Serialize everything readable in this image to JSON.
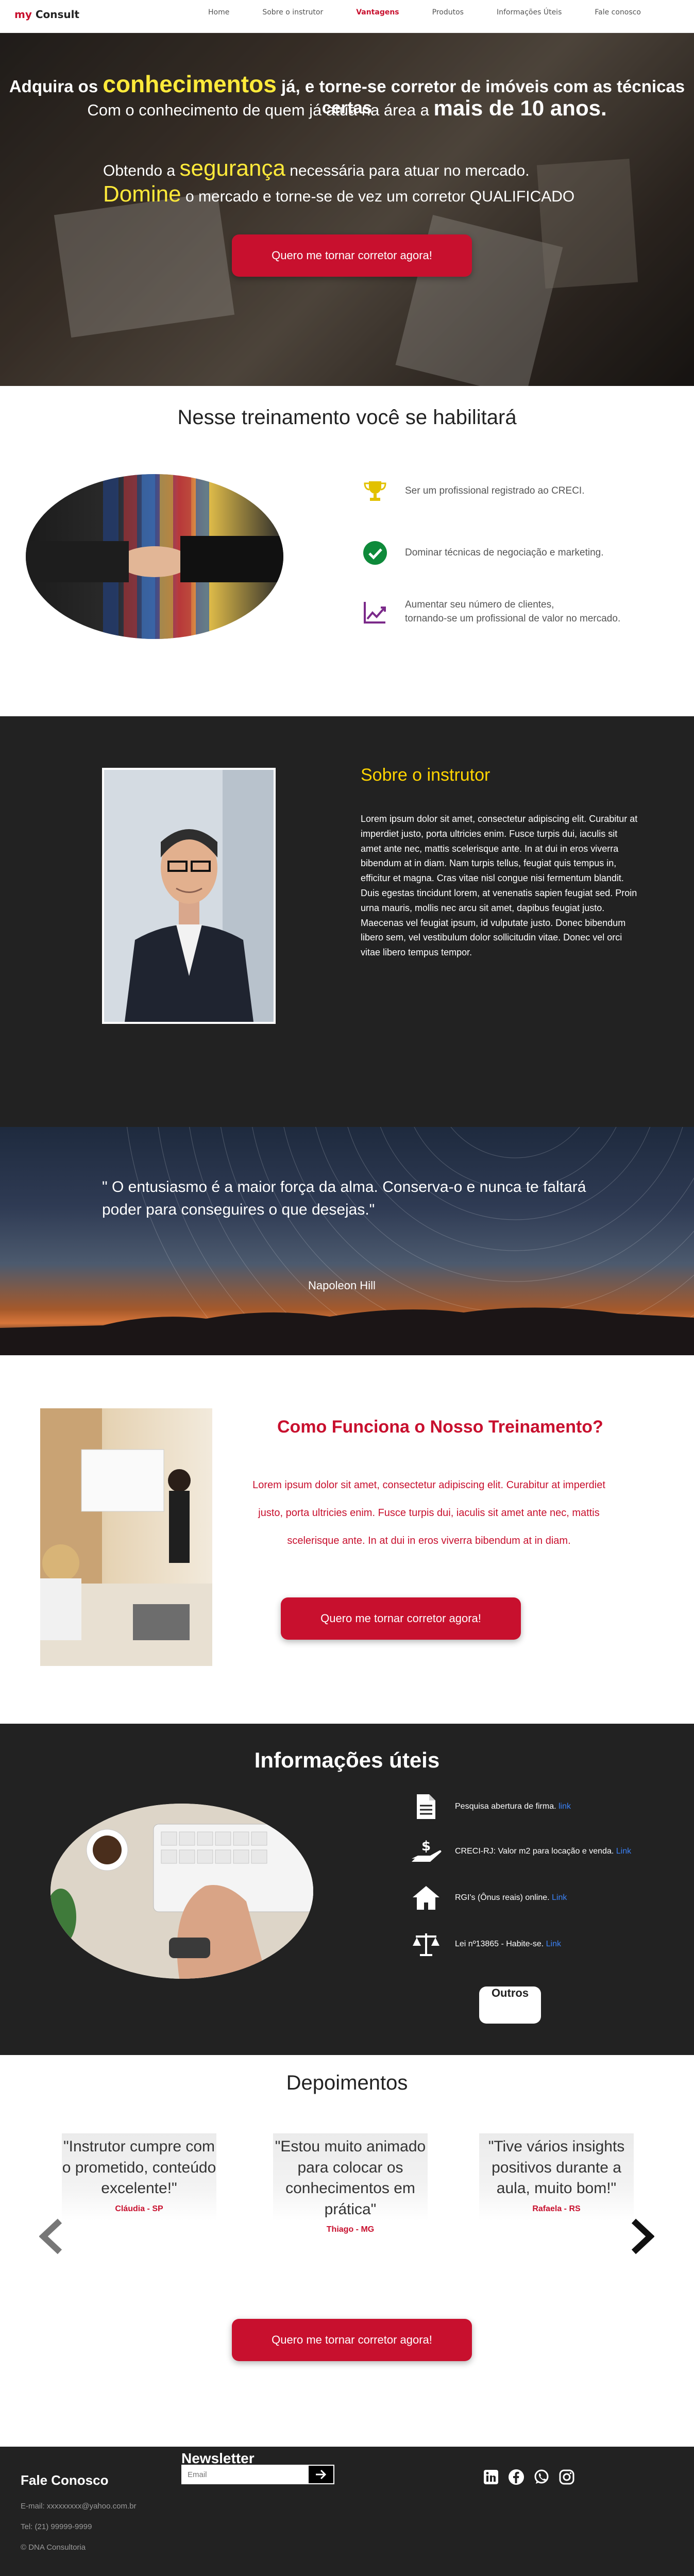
{
  "nav": {
    "logo_my": "my",
    "logo_consult": "Consult",
    "items": [
      "Home",
      "Sobre o instrutor",
      "Vantagens",
      "Produtos",
      "Informações Úteis",
      "Fale conosco"
    ],
    "active": "Vantagens"
  },
  "hero": {
    "line1_a": "Adquira os",
    "line1_b": "conhecimentos",
    "line1_c": "já, e torne-se corretor de imóveis com as técnicas certas",
    "line2_a": "Com o conhecimento de quem já atua na área a",
    "line2_b": "mais de 10 anos.",
    "line3_a": "Obtendo a",
    "line3_b": "segurança",
    "line3_c": "necessária para atuar no mercado.",
    "line4_a": "Domine",
    "line4_b": "o mercado e torne-se de vez um corretor QUALIFICADO",
    "cta": "Quero me tornar corretor agora!"
  },
  "habilitar": {
    "title": "Nesse treinamento você se habilitará",
    "items": [
      {
        "icon": "trophy-icon",
        "text": "Ser um profissional registrado ao CRECI."
      },
      {
        "icon": "check-circle-icon",
        "text": "Dominar técnicas de negociação e marketing."
      },
      {
        "icon": "trend-up-icon",
        "text_line1": "Aumentar seu número de clientes,",
        "text_line2": "tornando-se um profissional de valor no mercado."
      }
    ]
  },
  "instrutor": {
    "title": "Sobre o instrutor",
    "text": "Lorem ipsum dolor sit amet, consectetur adipiscing elit. Curabitur at imperdiet justo, porta ultricies enim. Fusce turpis dui, iaculis sit amet ante nec, mattis scelerisque ante. In at dui in eros viverra bibendum at in diam. Nam turpis tellus, feugiat quis tempus in, efficitur et magna. Cras vitae nisl congue nisi fermentum blandit. Duis egestas tincidunt lorem, at venenatis sapien feugiat sed. Proin urna mauris, mollis nec arcu sit amet, dapibus feugiat justo. Maecenas vel feugiat ipsum, id vulputate justo. Donec bibendum libero sem, vel vestibulum dolor sollicitudin vitae. Donec vel orci vitae libero tempus tempor."
  },
  "quote": {
    "text": "\" O entusiasmo é a maior força da alma. Conserva-o e nunca te faltará poder para conseguires o que desejas.\"",
    "author": "Napoleon Hill"
  },
  "como": {
    "title": "Como Funciona o Nosso Treinamento?",
    "text": "Lorem ipsum dolor sit amet, consectetur adipiscing elit. Curabitur at imperdiet justo, porta ultricies enim. Fusce turpis dui, iaculis sit amet ante nec, mattis scelerisque ante. In at dui in eros viverra bibendum at in diam.",
    "cta": "Quero me tornar corretor agora!"
  },
  "info": {
    "title": "Informações úteis",
    "items": [
      {
        "icon": "document-icon",
        "text": "Pesquisa abertura de firma.",
        "link": "link"
      },
      {
        "icon": "hand-money-icon",
        "text": "CRECI-RJ: Valor m2 para locação e venda.",
        "link": "Link"
      },
      {
        "icon": "house-icon",
        "text": "RGI's (Ônus reais) online.",
        "link": "Link"
      },
      {
        "icon": "scale-icon",
        "text": "Lei nº13865 - Habite-se.",
        "link": "Link"
      }
    ],
    "outros": "Outros"
  },
  "depoimentos": {
    "title": "Depoimentos",
    "items": [
      {
        "quote": "\"Instrutor cumpre com o prometido, conteúdo excelente!\"",
        "name": "Cláudia - SP"
      },
      {
        "quote": "\"Estou muito animado para colocar os conhecimentos em prática\"",
        "name": "Thiago - MG"
      },
      {
        "quote": "\"Tive vários insights positivos durante a aula, muito bom!\"",
        "name": "Rafaela - RS"
      }
    ],
    "cta": "Quero me tornar corretor agora!"
  },
  "footer": {
    "fale_title": "Fale Conosco",
    "email": "E-mail: xxxxxxxxx@yahoo.com.br",
    "tel": "Tel: (21) 99999-9999",
    "copyright": "© DNA Consultoria",
    "newsletter_title": "Newsletter",
    "newsletter_placeholder": "Email",
    "social": [
      "linkedin-icon",
      "facebook-icon",
      "whatsapp-icon",
      "instagram-icon"
    ]
  },
  "colors": {
    "brand_red": "#c8102e",
    "accent_yellow": "#ffea3a",
    "dark_bg": "#222222",
    "link_blue": "#3b82f6"
  }
}
